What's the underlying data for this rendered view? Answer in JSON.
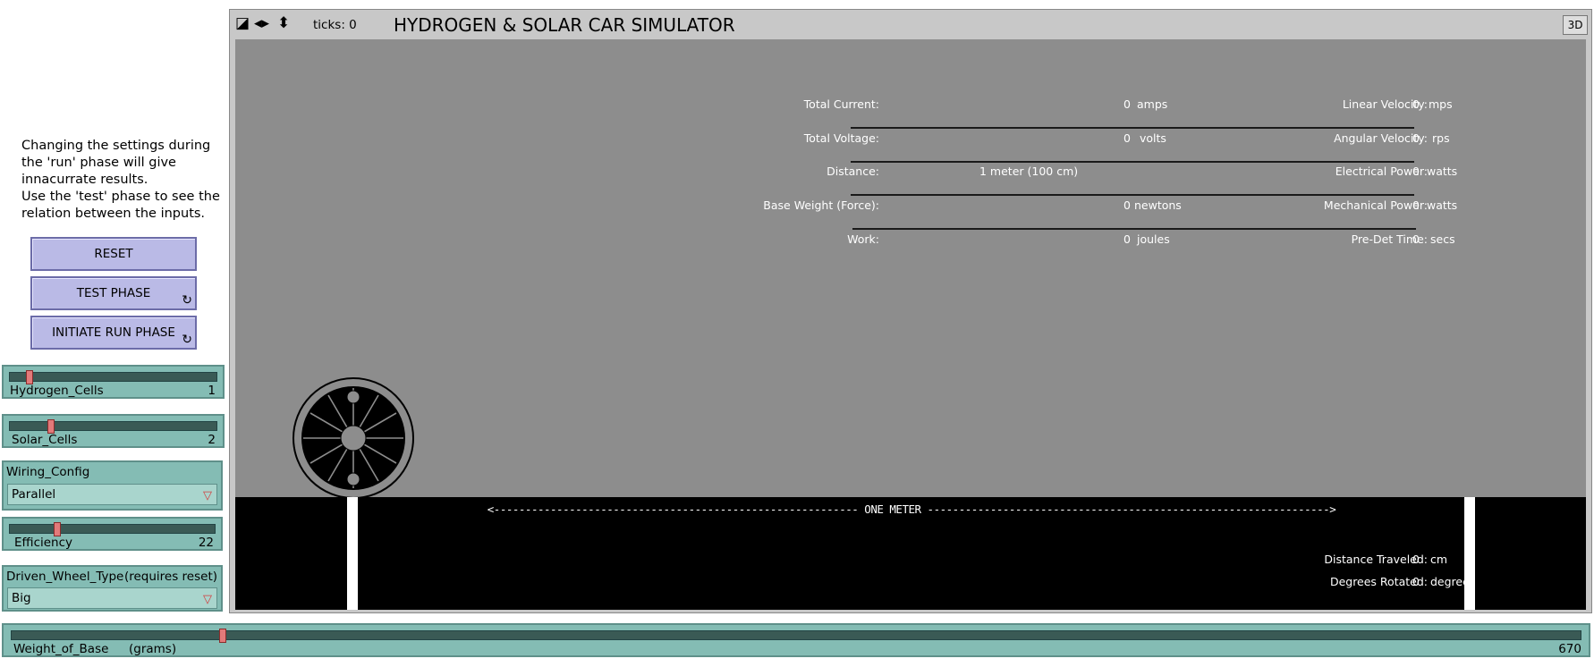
{
  "note": {
    "line1": "Changing the settings during",
    "line2": "the 'run' phase will give",
    "line3": "innacurrate results.",
    "line4": "Use the 'test' phase to see the",
    "line5": "relation between the inputs."
  },
  "buttons": {
    "reset": "RESET",
    "test": "TEST PHASE",
    "run": "INITIATE RUN PHASE",
    "forever_icon": "↻"
  },
  "sliders": {
    "hydrogen": {
      "label": "Hydrogen_Cells",
      "value": "1",
      "fraction": 0.08
    },
    "solar": {
      "label": "Solar_Cells",
      "value": "2",
      "fraction": 0.19
    },
    "efficiency": {
      "label": "Efficiency",
      "value": "22",
      "fraction": 0.22
    },
    "weight": {
      "label": "Weight_of_Base",
      "unit": "(grams)",
      "value": "670",
      "fraction": 0.133
    }
  },
  "choosers": {
    "wiring": {
      "label": "Wiring_Config",
      "value": "Parallel"
    },
    "wheel": {
      "label": "Driven_Wheel_Type",
      "note": "(requires reset)",
      "value": "Big"
    }
  },
  "view": {
    "ticks_label": "ticks: 0",
    "title": "HYDROGEN & SOLAR CAR SIMULATOR",
    "btn_3d": "3D",
    "meter_label": "<---------------------------------------------------------- ONE METER ---------------------------------------------------------------->"
  },
  "readouts": {
    "left": [
      {
        "label": "Total Current:",
        "value": "0",
        "unit": "amps"
      },
      {
        "label": "Total Voltage:",
        "value": "0",
        "unit": "volts"
      },
      {
        "label": "Distance:",
        "value": "1 meter (100 cm)",
        "unit": ""
      },
      {
        "label": "Base Weight (Force):",
        "value": "0",
        "unit": "newtons"
      },
      {
        "label": "Work:",
        "value": "0",
        "unit": "joules"
      }
    ],
    "right": [
      {
        "label": "Linear Velocity:",
        "value": "0",
        "unit": "mps"
      },
      {
        "label": "Angular Velocity:",
        "value": "0",
        "unit": "rps"
      },
      {
        "label": "Electrical Power:",
        "value": "0",
        "unit": "watts"
      },
      {
        "label": "Mechanical Power:",
        "value": "0",
        "unit": "watts"
      },
      {
        "label": "Pre-Det Time:",
        "value": "0",
        "unit": "secs"
      }
    ],
    "bottom": [
      {
        "label": "Distance Traveled:",
        "value": "0",
        "unit": "cm"
      },
      {
        "label": "Degrees Rotated:",
        "value": "0",
        "unit": "degrees"
      }
    ]
  }
}
